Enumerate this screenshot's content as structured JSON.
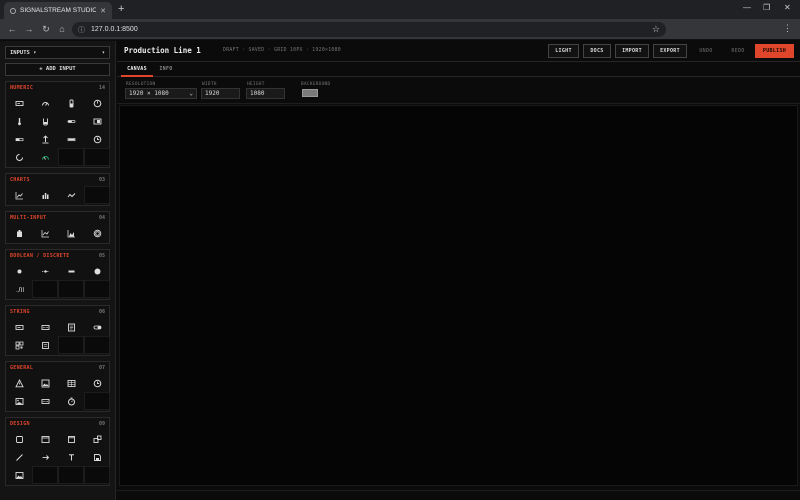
{
  "browser": {
    "tab_title": "SIGNALSTREAM STUDIO",
    "url": "127.0.0.1:8500"
  },
  "sidebar": {
    "dropdown_label": "INPUTS",
    "add_input_label": "+ ADD INPUT",
    "groups": [
      {
        "name": "NUMERIC",
        "count": "14",
        "icons": [
          "numeric-box-icon",
          "gauge-icon",
          "tank-icon",
          "dial-icon",
          "thermometer-icon",
          "beaker-icon",
          "slider-icon",
          "meter-icon",
          "progress-icon",
          "level-icon",
          "bar-icon",
          "clock-icon",
          "spinner-icon",
          "speedometer-icon"
        ]
      },
      {
        "name": "CHARTS",
        "count": "03",
        "icons": [
          "line-chart-icon",
          "bar-chart-icon",
          "trend-icon"
        ]
      },
      {
        "name": "MULTI-INPUT",
        "count": "04",
        "icons": [
          "stacked-bar-icon",
          "multi-line-icon",
          "area-chart-icon",
          "radar-icon"
        ]
      },
      {
        "name": "BOOLEAN / DISCRETE",
        "count": "05",
        "icons": [
          "indicator-dot-icon",
          "switch-icon",
          "toggle-bar-icon",
          "lamp-icon",
          "discrete-icon"
        ]
      },
      {
        "name": "STRING",
        "count": "06",
        "icons": [
          "text-field-icon",
          "keyboard-icon",
          "document-icon",
          "label-icon",
          "qr-icon",
          "list-icon"
        ]
      },
      {
        "name": "GENERAL",
        "count": "07",
        "icons": [
          "warning-icon",
          "image-icon",
          "table-icon",
          "timer-icon",
          "picture-icon",
          "frame-icon",
          "stopwatch-icon"
        ]
      },
      {
        "name": "DESIGN",
        "count": "09",
        "icons": [
          "rectangle-icon",
          "window-icon",
          "panel-icon",
          "shapes-icon",
          "line-icon",
          "arrow-icon",
          "text-icon",
          "save-icon",
          "photo-icon"
        ]
      }
    ]
  },
  "header": {
    "title": "Production Line 1",
    "meta": "DRAFT · SAVED · GRID 10PX · 1920×1080",
    "buttons": {
      "light": "LIGHT",
      "docs": "DOCS",
      "import": "IMPORT",
      "export": "EXPORT",
      "undo": "UNDO",
      "redo": "REDO",
      "publish": "PUBLISH"
    }
  },
  "tabs": {
    "canvas": "CANVAS",
    "info": "INFO"
  },
  "properties": {
    "resolution_label": "RESOLUTION",
    "resolution_value": "1920 × 1080",
    "width_label": "WIDTH",
    "width_value": "1920",
    "height_label": "HEIGHT",
    "height_value": "1080",
    "background_label": "BACKGROUND",
    "background_color": "#7a7a7a"
  },
  "colors": {
    "accent": "#e0462b"
  }
}
